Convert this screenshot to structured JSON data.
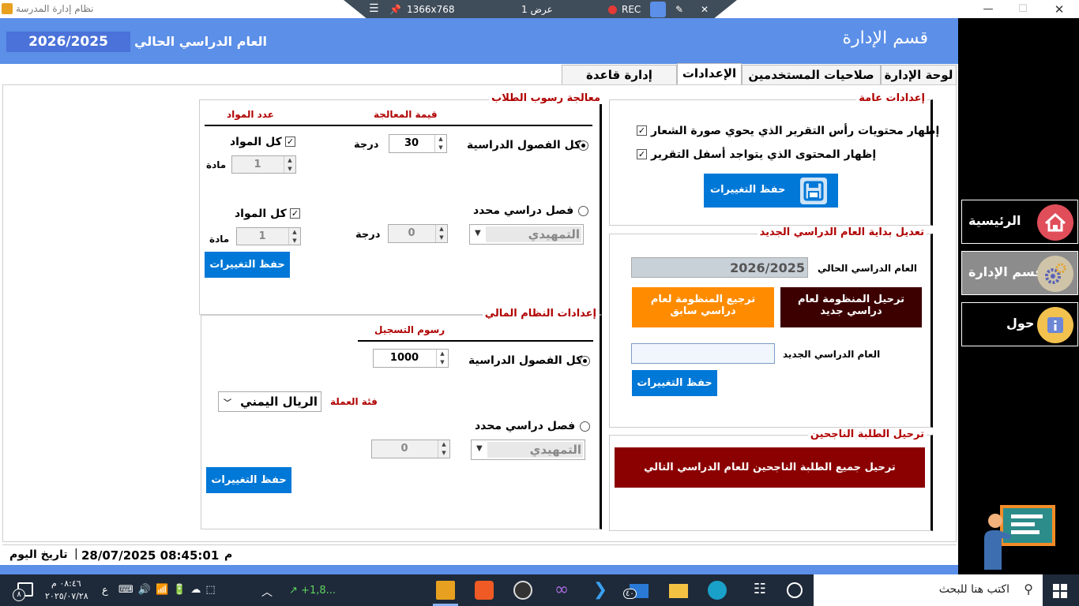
{
  "window": {
    "title": "نظام إدارة المدرسة",
    "minimize": "—",
    "maximize": "☐",
    "close": "✕"
  },
  "remote_bar": {
    "resolution": "1366x768",
    "view": "عرض 1",
    "rec": "REC"
  },
  "header": {
    "title": "قسم الإدارة",
    "year_label": "العام الدراسي الحالي",
    "year_value": "2026/2025"
  },
  "tabs": [
    {
      "label": "لوحة الإدارة"
    },
    {
      "label": "صلاحيات المستخدمين"
    },
    {
      "label": "الإعدادات"
    },
    {
      "label": "إدارة قاعدة البيانات"
    }
  ],
  "sidebar": {
    "items": [
      {
        "label": "الرئيسية"
      },
      {
        "label": "قسم الإدارة"
      },
      {
        "label": "حول"
      }
    ]
  },
  "general": {
    "title": "إعدادات عامة",
    "opt1": "إظهار محتويات رأس التقرير الذي يحوي صورة الشعار",
    "opt2": "إظهار المحتوى الذي يتواجد أسفل التقرير",
    "check_mark": "✓",
    "save": "حفظ التغييرات"
  },
  "year_start": {
    "title": "تعديل بداية العام الدراسي الجديد",
    "current_label": "العام الدراسي الحالي",
    "current_value": "2026/2025",
    "promote_button": "ترحيل المنظومة لعام دراسي جديد",
    "rollback_button": "ترجيع المنظومة لعام دراسي سابق",
    "new_label": "العام الدراسي الجديد",
    "new_value": "",
    "save": "حفظ التغييرات"
  },
  "promote_students": {
    "title": "ترحيل الطلبة الناجحين",
    "button": "ترحيل جميع الطلبة الناجحين للعام الدراسي التالي"
  },
  "failure": {
    "title": "معالجة رسوب الطلاب",
    "col_value": "قيمة المعالجة",
    "col_subjects": "عدد المواد",
    "all_classes": "كل الفصول الدراسية",
    "specific_class": "فصل دراسي محدد",
    "grade_unit": "درجة",
    "value1": "30",
    "value2": "0",
    "all_subjects": "كل المواد",
    "subject_unit": "مادة",
    "subjects1": "1",
    "subjects2": "1",
    "class_select": "التمهيدي",
    "save": "حفظ التغييرات"
  },
  "finance": {
    "title": "إعدادات النظام المالي",
    "col_fees": "رسوم التسجيل",
    "all_classes": "كل الفصول الدراسية",
    "fees_value": "1000",
    "currency_label": "فئة العملة",
    "currency_value": "الريال اليمني",
    "specific_class": "فصل دراسي محدد",
    "fees2": "0",
    "class_select": "التمهيدي",
    "save": "حفظ التغييرات"
  },
  "status": {
    "label": "تاريخ اليوم",
    "datetime": "28/07/2025 08:45:01",
    "ampm": "م"
  },
  "taskbar": {
    "search_placeholder": "اكتب هنا للبحث",
    "stock": "+1,8...",
    "time": "٠٨:٤٦ م",
    "date": "٢٠٢٥/٠٧/٢٨",
    "lang": "ع",
    "notif": "٨",
    "mail_badge": "٤٠"
  }
}
